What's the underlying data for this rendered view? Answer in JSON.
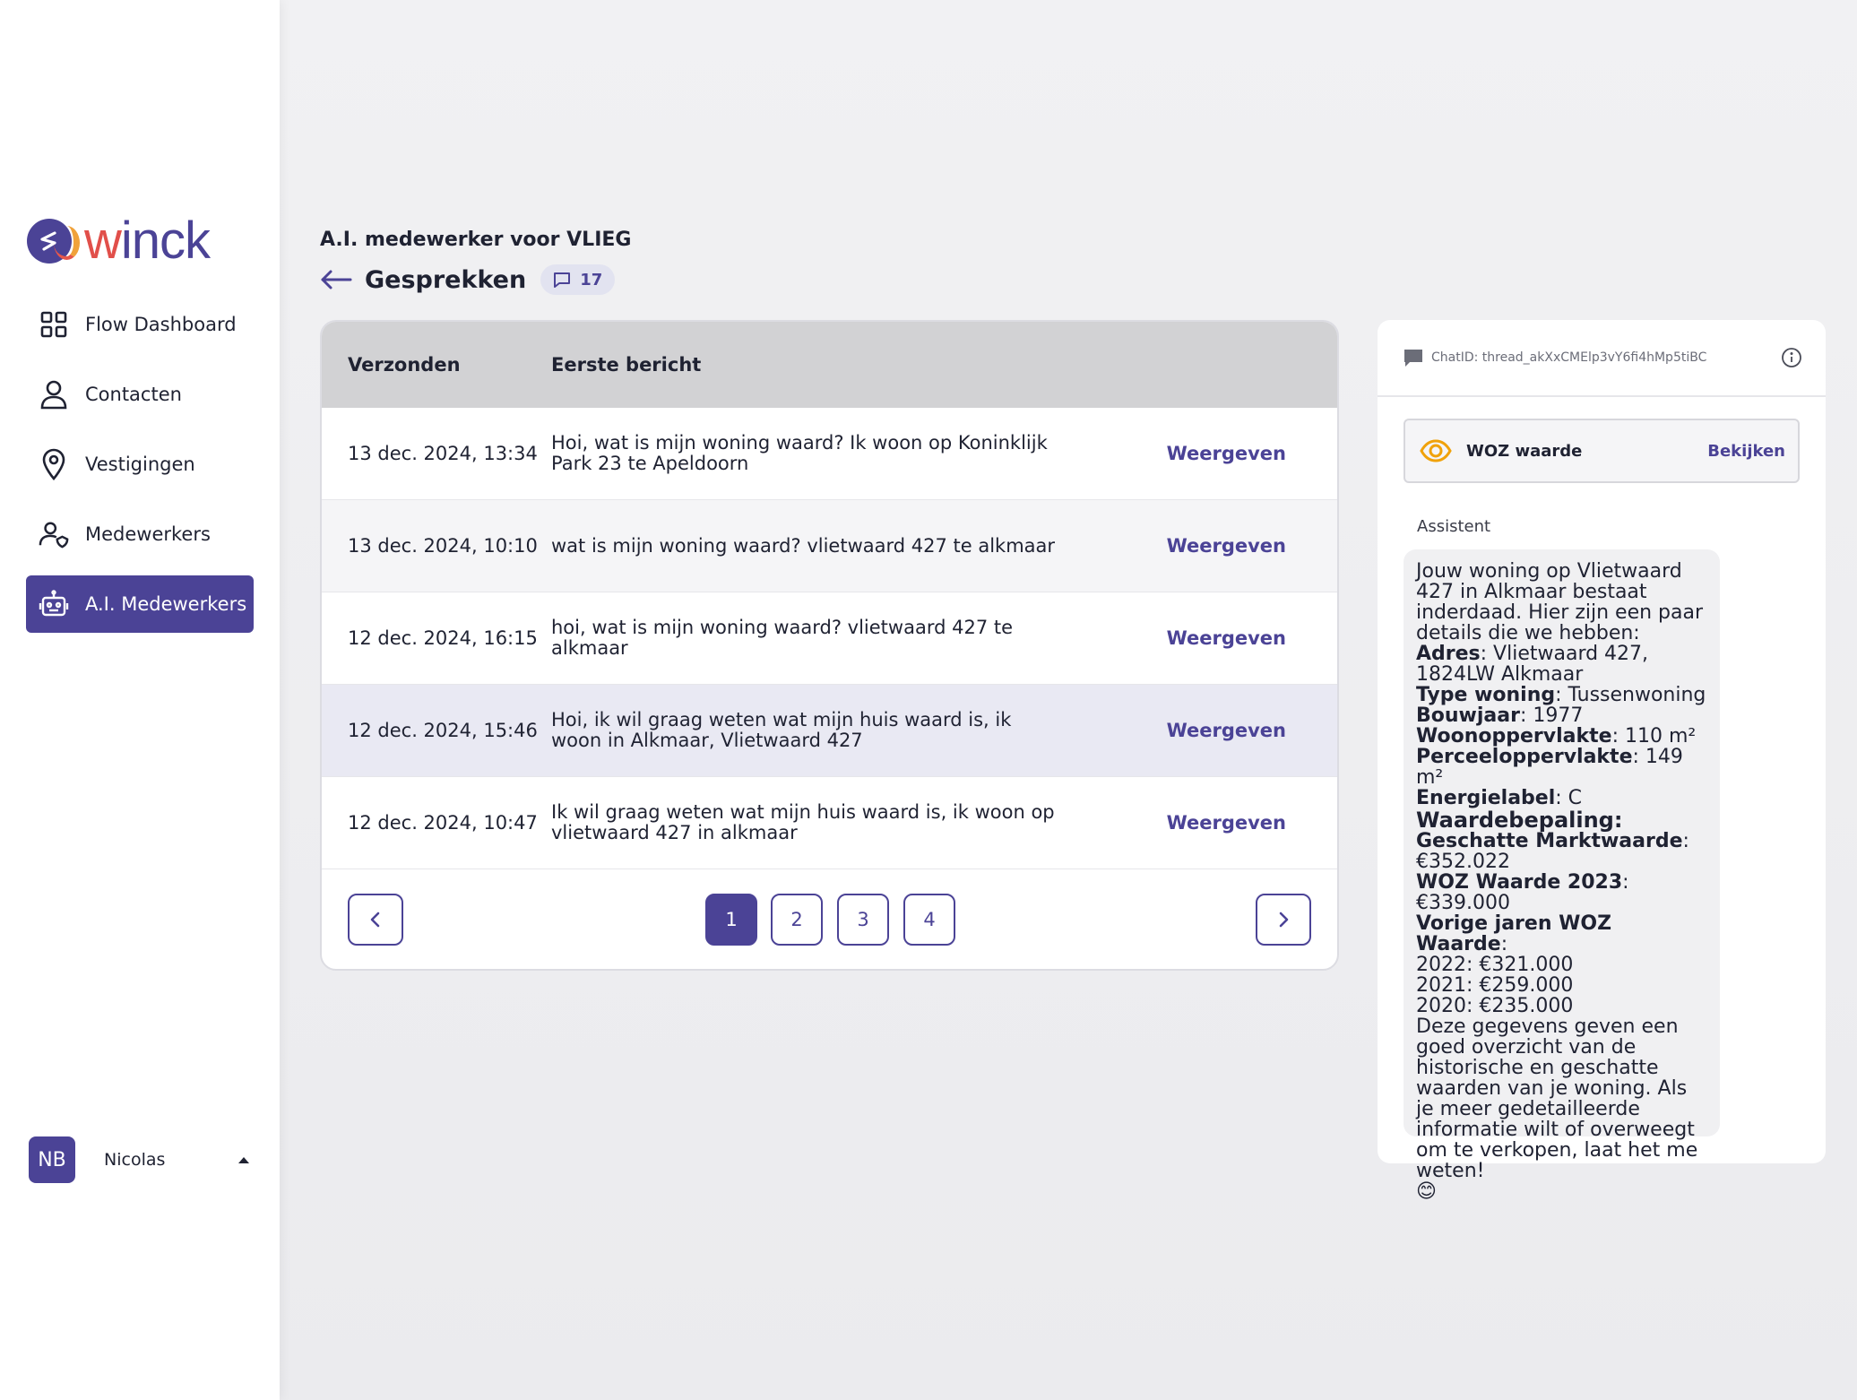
{
  "brand": {
    "name_accent": "w",
    "name_rest": "inck"
  },
  "sidebar": {
    "items": [
      {
        "label": "Flow Dashboard",
        "icon": "grid-icon"
      },
      {
        "label": "Contacten",
        "icon": "person-icon"
      },
      {
        "label": "Vestigingen",
        "icon": "location-pin-icon"
      },
      {
        "label": "Medewerkers",
        "icon": "user-shield-icon"
      },
      {
        "label": "A.I. Medewerkers",
        "icon": "robot-icon",
        "active": true
      }
    ],
    "user": {
      "initials": "NB",
      "name": "Nicolas"
    }
  },
  "header": {
    "subtitle": "A.I. medewerker voor VLIEG",
    "title": "Gesprekken",
    "count": "17"
  },
  "table": {
    "columns": [
      "Verzonden",
      "Eerste bericht"
    ],
    "action_label": "Weergeven",
    "rows": [
      {
        "date": "13 dec. 2024, 13:34",
        "message": "Hoi, wat is mijn woning waard? Ik woon op Koninklijk Park 23 te Apeldoorn"
      },
      {
        "date": "13 dec. 2024, 10:10",
        "message": "wat is mijn woning waard? vlietwaard 427 te alkmaar"
      },
      {
        "date": "12 dec. 2024, 16:15",
        "message": "hoi, wat is mijn woning waard? vlietwaard 427 te alkmaar"
      },
      {
        "date": "12 dec. 2024, 15:46",
        "message": "Hoi, ik wil graag weten wat mijn huis waard is, ik woon in Alkmaar, Vlietwaard 427"
      },
      {
        "date": "12 dec. 2024, 10:47",
        "message": "Ik wil graag weten wat mijn huis waard is, ik woon op vlietwaard 427 in alkmaar"
      }
    ],
    "pages": [
      "1",
      "2",
      "3",
      "4"
    ],
    "current_page": "1"
  },
  "chat": {
    "chat_id": "ChatID: thread_akXxCMElp3vY6fi4hMp5tiBC",
    "tool": {
      "label": "WOZ waarde",
      "action": "Bekijken"
    },
    "role": "Assistent",
    "intro": "Jouw woning op Vlietwaard 427 in Alkmaar bestaat inderdaad. Hier zijn een paar details die we hebben:",
    "details": [
      {
        "key": "Adres",
        "value": ": Vlietwaard 427, 1824LW Alkmaar"
      },
      {
        "key": "Type woning",
        "value": ": Tussenwoning"
      },
      {
        "key": "Bouwjaar",
        "value": ": 1977"
      },
      {
        "key": "Woonoppervlakte",
        "value": ": 110 m²"
      },
      {
        "key": "Perceeloppervlakte",
        "value": ": 149 m²"
      },
      {
        "key": "Energielabel",
        "value": ": C"
      }
    ],
    "heading": "Waardebepaling:",
    "valuation": [
      {
        "key": "Geschatte Marktwaarde",
        "value": ": €352.022"
      },
      {
        "key": "WOZ Waarde 2023",
        "value": ": €339.000"
      },
      {
        "key": "Vorige jaren WOZ Waarde",
        "value": ":"
      }
    ],
    "history": [
      "2022: €321.000",
      "2021: €259.000",
      "2020: €235.000"
    ],
    "closing": "Deze gegevens geven een goed overzicht van de historische en geschatte waarden van je woning. Als je meer gedetailleerde informatie wilt of overweegt om te verkopen, laat het me weten!",
    "emoji": "😊"
  }
}
